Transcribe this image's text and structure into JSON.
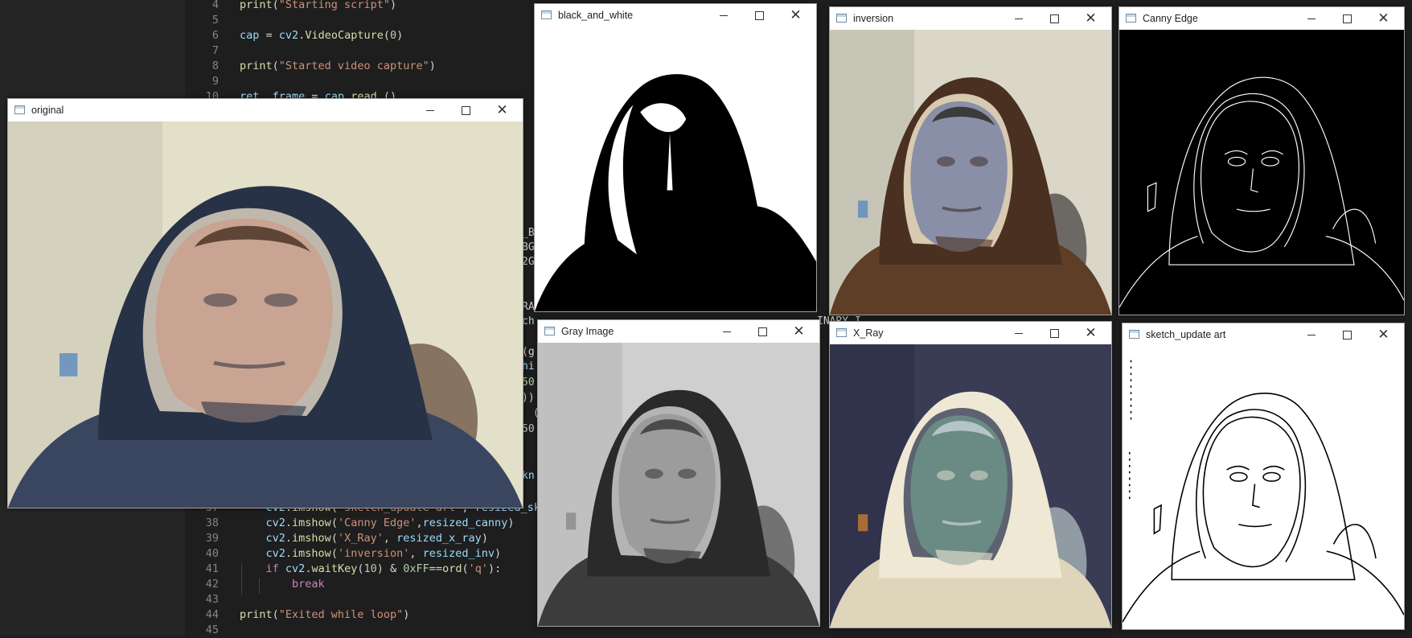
{
  "editor": {
    "lines": [
      {
        "num": "4",
        "parts": [
          [
            "fn",
            "print"
          ],
          [
            "pl",
            "("
          ],
          [
            "str",
            "\"Starting script\""
          ],
          [
            "pl",
            ")"
          ]
        ]
      },
      {
        "num": "5",
        "parts": []
      },
      {
        "num": "6",
        "parts": [
          [
            "var",
            "cap"
          ],
          [
            "pl",
            " = "
          ],
          [
            "var",
            "cv2"
          ],
          [
            "pl",
            "."
          ],
          [
            "fn",
            "VideoCapture"
          ],
          [
            "pl",
            "("
          ],
          [
            "num",
            "0"
          ],
          [
            "pl",
            ")"
          ]
        ]
      },
      {
        "num": "7",
        "parts": []
      },
      {
        "num": "8",
        "parts": [
          [
            "fn",
            "print"
          ],
          [
            "pl",
            "("
          ],
          [
            "str",
            "\"Started video capture\""
          ],
          [
            "pl",
            ")"
          ]
        ]
      },
      {
        "num": "9",
        "parts": []
      },
      {
        "num": "10",
        "parts": [
          [
            "var",
            "ret"
          ],
          [
            "pl",
            ", "
          ],
          [
            "var",
            "frame"
          ],
          [
            "pl",
            " = "
          ],
          [
            "var",
            "cap"
          ],
          [
            "pl",
            "."
          ],
          [
            "fn",
            "read"
          ],
          [
            "pl",
            " ()"
          ]
        ]
      },
      {
        "num": "37",
        "parts": [
          [
            "pl",
            "    "
          ],
          [
            "var",
            "cv2"
          ],
          [
            "pl",
            "."
          ],
          [
            "fn",
            "imshow"
          ],
          [
            "pl",
            "("
          ],
          [
            "str",
            "'sketch_update art'"
          ],
          [
            "pl",
            ", "
          ],
          [
            "var",
            "resized_sket"
          ]
        ]
      },
      {
        "num": "38",
        "parts": [
          [
            "pl",
            "    "
          ],
          [
            "var",
            "cv2"
          ],
          [
            "pl",
            "."
          ],
          [
            "fn",
            "imshow"
          ],
          [
            "pl",
            "("
          ],
          [
            "str",
            "'Canny Edge'"
          ],
          [
            "pl",
            ","
          ],
          [
            "var",
            "resized_canny"
          ],
          [
            "pl",
            ")"
          ]
        ]
      },
      {
        "num": "39",
        "parts": [
          [
            "pl",
            "    "
          ],
          [
            "var",
            "cv2"
          ],
          [
            "pl",
            "."
          ],
          [
            "fn",
            "imshow"
          ],
          [
            "pl",
            "("
          ],
          [
            "str",
            "'X_Ray'"
          ],
          [
            "pl",
            ", "
          ],
          [
            "var",
            "resized_x_ray"
          ],
          [
            "pl",
            ")"
          ]
        ]
      },
      {
        "num": "40",
        "parts": [
          [
            "pl",
            "    "
          ],
          [
            "var",
            "cv2"
          ],
          [
            "pl",
            "."
          ],
          [
            "fn",
            "imshow"
          ],
          [
            "pl",
            "("
          ],
          [
            "str",
            "'inversion'"
          ],
          [
            "pl",
            ", "
          ],
          [
            "var",
            "resized_inv"
          ],
          [
            "pl",
            ")"
          ]
        ]
      },
      {
        "num": "41",
        "parts": [
          [
            "pl",
            "    "
          ],
          [
            "kw",
            "if"
          ],
          [
            "pl",
            " "
          ],
          [
            "var",
            "cv2"
          ],
          [
            "pl",
            "."
          ],
          [
            "fn",
            "waitKey"
          ],
          [
            "pl",
            "("
          ],
          [
            "num",
            "10"
          ],
          [
            "pl",
            ") & "
          ],
          [
            "num",
            "0xFF"
          ],
          [
            "pl",
            "=="
          ],
          [
            "fn",
            "ord"
          ],
          [
            "pl",
            "("
          ],
          [
            "str",
            "'q'"
          ],
          [
            "pl",
            "):"
          ]
        ]
      },
      {
        "num": "42",
        "parts": [
          [
            "pl",
            "        "
          ],
          [
            "kw",
            "break"
          ]
        ]
      },
      {
        "num": "43",
        "parts": []
      },
      {
        "num": "44",
        "parts": [
          [
            "fn",
            "print"
          ],
          [
            "pl",
            "("
          ],
          [
            "str",
            "\"Exited while loop\""
          ],
          [
            "pl",
            ")"
          ]
        ]
      },
      {
        "num": "45",
        "parts": []
      }
    ],
    "fragments": [
      {
        "text": "_B",
        "color": "#d4d4d4"
      },
      {
        "text": "BG",
        "color": "#d4d4d4"
      },
      {
        "text": "2G",
        "color": "#d4d4d4"
      },
      {
        "text": "RAY)",
        "color": "#d4d4d4"
      },
      {
        "text": "ch",
        "color": "#9cdcfe"
      },
      {
        "text": "(g",
        "color": "#d4d4d4"
      },
      {
        "text": "hi",
        "color": "#9cdcfe"
      },
      {
        "text": "50",
        "color": "#b5cea8"
      },
      {
        "text": "))",
        "color": "#d4d4d4"
      },
      {
        "text": " (",
        "color": "#d4d4d4"
      },
      {
        "text": "50",
        "color": "#b5cea8"
      },
      {
        "text": "kn",
        "color": "#9cdcfe"
      },
      {
        "text": "INARY_I",
        "color": "#d4d4d4"
      }
    ]
  },
  "windows": [
    {
      "id": "original",
      "title": "original",
      "effect": "original"
    },
    {
      "id": "black_and_white",
      "title": "black_and_white",
      "effect": "bw"
    },
    {
      "id": "inversion",
      "title": "inversion",
      "effect": "inversion"
    },
    {
      "id": "canny",
      "title": "Canny Edge",
      "effect": "canny"
    },
    {
      "id": "gray",
      "title": "Gray Image",
      "effect": "gray"
    },
    {
      "id": "xray",
      "title": "X_Ray",
      "effect": "xray"
    },
    {
      "id": "sketch",
      "title": "sketch_update art",
      "effect": "sketch"
    }
  ],
  "icons": {
    "minimize": "minimize-icon",
    "maximize": "maximize-icon",
    "close": "close-icon",
    "close_glyph": "✕",
    "app": "window-app-icon"
  }
}
